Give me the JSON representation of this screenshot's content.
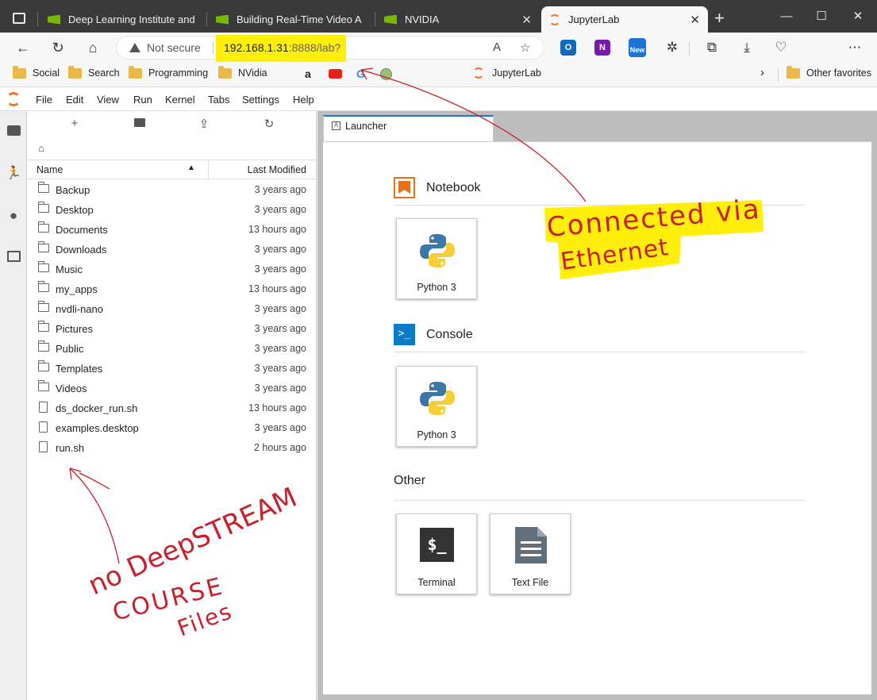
{
  "browser": {
    "tabs": [
      {
        "label": "Deep Learning Institute and",
        "active": false
      },
      {
        "label": "Building Real-Time Video A",
        "active": false
      },
      {
        "label": "NVIDIA",
        "active": false
      },
      {
        "label": "JupyterLab",
        "active": true
      }
    ],
    "new_tab_label": "+",
    "window_controls": {
      "minimize": "—",
      "maximize": "☐",
      "close": "✕"
    },
    "tab_close": "✕"
  },
  "address": {
    "security_label": "Not secure",
    "url_host": "192.168.1.31",
    "url_rest": ":8888/lab?",
    "ext_new_badge": "New"
  },
  "bookmarks": [
    {
      "label": "Social",
      "type": "folder"
    },
    {
      "label": "Search",
      "type": "folder"
    },
    {
      "label": "Programming",
      "type": "folder"
    },
    {
      "label": "NVidia",
      "type": "folder"
    },
    {
      "label": "JupyterLab",
      "type": "site"
    }
  ],
  "bookmarks_other": "Other favorites",
  "jupyter": {
    "menu": [
      "File",
      "Edit",
      "View",
      "Run",
      "Kernel",
      "Tabs",
      "Settings",
      "Help"
    ],
    "file_browser": {
      "col_name": "Name",
      "col_modified": "Last Modified",
      "items": [
        {
          "name": "Backup",
          "modified": "3 years ago",
          "type": "dir"
        },
        {
          "name": "Desktop",
          "modified": "3 years ago",
          "type": "dir"
        },
        {
          "name": "Documents",
          "modified": "13 hours ago",
          "type": "dir"
        },
        {
          "name": "Downloads",
          "modified": "3 years ago",
          "type": "dir"
        },
        {
          "name": "Music",
          "modified": "3 years ago",
          "type": "dir"
        },
        {
          "name": "my_apps",
          "modified": "13 hours ago",
          "type": "dir"
        },
        {
          "name": "nvdli-nano",
          "modified": "3 years ago",
          "type": "dir"
        },
        {
          "name": "Pictures",
          "modified": "3 years ago",
          "type": "dir"
        },
        {
          "name": "Public",
          "modified": "3 years ago",
          "type": "dir"
        },
        {
          "name": "Templates",
          "modified": "3 years ago",
          "type": "dir"
        },
        {
          "name": "Videos",
          "modified": "3 years ago",
          "type": "dir"
        },
        {
          "name": "ds_docker_run.sh",
          "modified": "13 hours ago",
          "type": "file"
        },
        {
          "name": "examples.desktop",
          "modified": "3 years ago",
          "type": "file"
        },
        {
          "name": "run.sh",
          "modified": "2 hours ago",
          "type": "file"
        }
      ]
    },
    "launcher": {
      "tab_label": "Launcher",
      "sections": {
        "notebook": {
          "title": "Notebook",
          "cards": [
            "Python 3"
          ]
        },
        "console": {
          "title": "Console",
          "cards": [
            "Python 3"
          ]
        },
        "other": {
          "title": "Other",
          "cards": [
            "Terminal",
            "Text File"
          ]
        }
      }
    }
  },
  "annotations": {
    "top_right": [
      "Connected via",
      "Ethernet"
    ],
    "bottom_left": [
      "no DeepSTREAM",
      "COURSE",
      "Files"
    ],
    "highlight_color": "#ffef0a",
    "ink_color": "#c8202a"
  },
  "colors": {
    "tabstrip": "#3a3a3a",
    "nvidia_green": "#76b900",
    "jupyter_orange": "#f37726",
    "accent_blue": "#1976d2"
  }
}
